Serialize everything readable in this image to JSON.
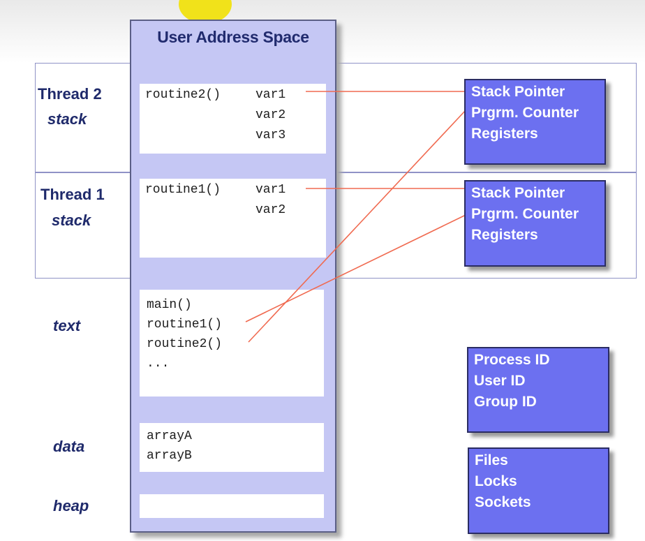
{
  "column": {
    "title": "User Address Space"
  },
  "segments": [
    {
      "thread": "Thread 2",
      "kind": "stack"
    },
    {
      "thread": "Thread 1",
      "kind": "stack"
    },
    {
      "kind": "text"
    },
    {
      "kind": "data"
    },
    {
      "kind": "heap"
    }
  ],
  "thread2_stack": {
    "routine": "routine2()",
    "vars": [
      "var1",
      "var2",
      "var3"
    ]
  },
  "thread1_stack": {
    "routine": "routine1()",
    "vars": [
      "var1",
      "var2"
    ]
  },
  "text_segment": {
    "lines": [
      "main()",
      "routine1()",
      "routine2()",
      "..."
    ]
  },
  "data_segment": {
    "lines": [
      "arrayA",
      "arrayB"
    ]
  },
  "thread2_regs": [
    "Stack Pointer",
    "Prgrm. Counter",
    "Registers"
  ],
  "thread1_regs": [
    "Stack Pointer",
    "Prgrm. Counter",
    "Registers"
  ],
  "process_ids": [
    "Process ID",
    "User ID",
    "Group ID"
  ],
  "resources": [
    "Files",
    "Locks",
    "Sockets"
  ],
  "colors": {
    "column": "#c5c7f4",
    "box": "#6c70f0",
    "line": "#f06a50",
    "label": "#1f2a6b"
  }
}
